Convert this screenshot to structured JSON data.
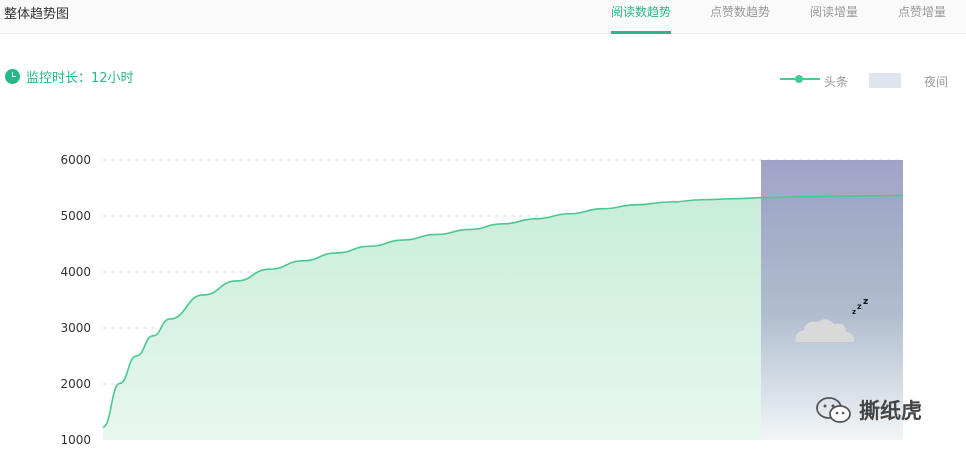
{
  "header": {
    "title": "整体趋势图",
    "tabs": [
      {
        "label": "阅读数趋势",
        "active": true
      },
      {
        "label": "点赞数趋势",
        "active": false
      },
      {
        "label": "阅读增量",
        "active": false
      },
      {
        "label": "点赞增量",
        "active": false
      }
    ]
  },
  "monitor": {
    "label": "监控时长：",
    "value": "12小时"
  },
  "legend": {
    "series_label": "头条",
    "night_label": "夜间"
  },
  "colors": {
    "accent": "#27b889",
    "line": "#49c98f",
    "night_top": "#9397bf",
    "night_bottom": "#f3f5f8"
  },
  "watermark": {
    "text": "撕纸虎"
  },
  "chart_data": {
    "type": "area",
    "title": "",
    "xlabel": "",
    "ylabel": "",
    "ylim": [
      1000,
      6000
    ],
    "yticks": [
      "6000",
      "5000",
      "4000",
      "3000",
      "2000",
      "1000"
    ],
    "grid": true,
    "series": [
      {
        "name": "头条",
        "x": [
          0,
          0.25,
          0.5,
          0.75,
          1,
          1.5,
          2,
          2.5,
          3,
          3.5,
          4,
          4.5,
          5,
          5.5,
          6,
          6.5,
          7,
          7.5,
          8,
          8.5,
          9,
          9.5,
          10,
          10.5,
          11,
          11.5,
          12
        ],
        "values": [
          1230,
          2010,
          2500,
          2860,
          3160,
          3590,
          3840,
          4050,
          4200,
          4340,
          4460,
          4570,
          4670,
          4760,
          4860,
          4950,
          5040,
          5130,
          5200,
          5250,
          5290,
          5310,
          5330,
          5345,
          5355,
          5360,
          5365
        ]
      }
    ],
    "night_band": {
      "x_start": 9.87,
      "x_end": 12,
      "label": "夜间"
    }
  }
}
